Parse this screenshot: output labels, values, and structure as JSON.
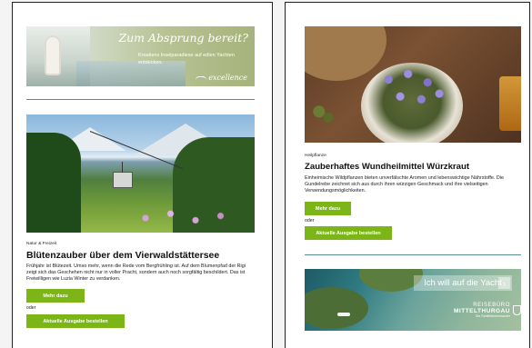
{
  "left": {
    "banner": {
      "headline": "Zum Absprung bereit?",
      "subline": "Kroatiens Inselparadiese auf edlen Yachten entdecken.",
      "logo": "excellence"
    },
    "article": {
      "category": "Natur & Freizeit",
      "title": "Blütenzauber über dem Vierwaldstättersee",
      "body": "Frühjahr ist Blütezeit. Umso mehr, wenn die Rede vom Bergfrühling ist. Auf dem Blumenpfad der Rigi zeigt sich das Geschehen nicht nur in voller Pracht, sondern auch noch sorgfältig beschildert. Das ist Freiwilligen wie Luzia Winter zu verdanken.",
      "more_label": "Mehr dazu",
      "or_label": "oder",
      "order_label": "Aktuelle Ausgabe bestellen"
    }
  },
  "right": {
    "article": {
      "category": "Heilpflanze",
      "title": "Zauberhaftes Wundheilmittel Würzkraut",
      "body": "Einheimische Wildpflanzen bieten unverfälschte Aromen und lebenswichtige Nährstoffe. Die Gundelrebe zeichnet sich aus durch ihren würzigen Geschmack und ihre vielseitigen Verwendungsmöglichkeiten.",
      "more_label": "Mehr dazu",
      "or_label": "oder",
      "order_label": "Aktuelle Ausgabe bestellen"
    },
    "banner": {
      "cta": "Ich will auf die Yacht",
      "cta_arrow": "›",
      "brand_line1": "REISEBÜRO",
      "brand_line2": "MITTELTHURGAU",
      "brand_line3": "Die Schiffsferienmacher"
    }
  },
  "colors": {
    "accent_green": "#7cb518",
    "divider_teal": "#5a8a94"
  }
}
